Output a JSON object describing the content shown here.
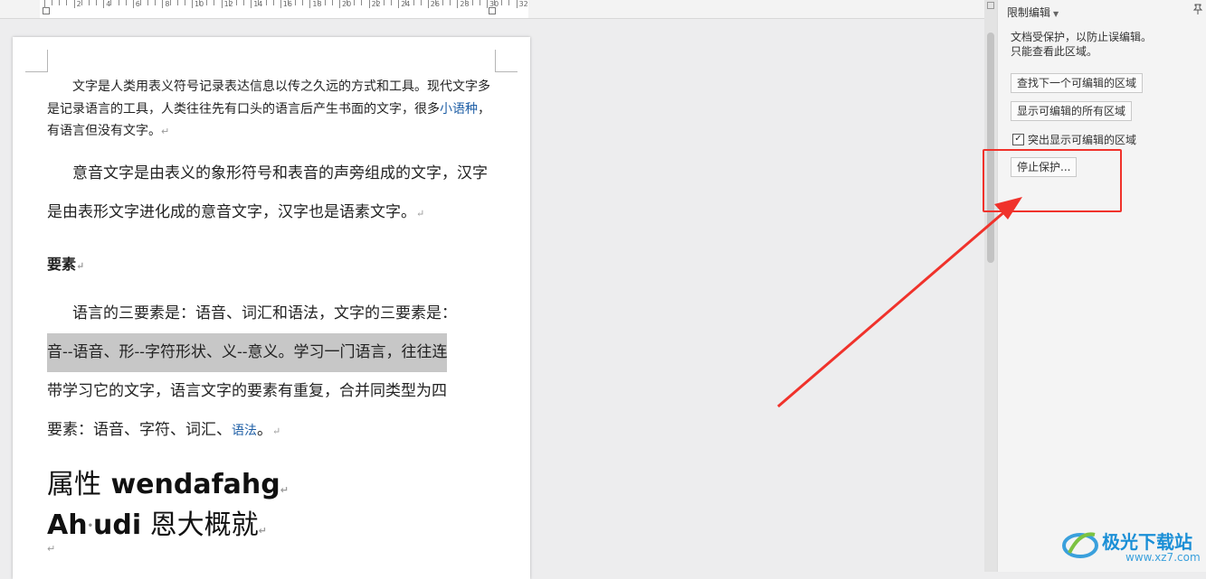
{
  "ruler": {
    "numbers": [
      "2",
      "4",
      "6",
      "8",
      "10",
      "12",
      "14",
      "16",
      "18",
      "20",
      "22",
      "24",
      "26",
      "28",
      "30",
      "32"
    ]
  },
  "document": {
    "para1": {
      "a": "文字是人类用表义符号记录表达信息以传之久远的方式和工具。现代文字多是记录语言的工具，人类往往先有口头的语言后产生书面的文字，很多",
      "link": "小语种",
      "b": "，有语言但没有文字。"
    },
    "para2": "意音文字是由表义的象形符号和表音的声旁组成的文字，汉字是由表形文字进化成的意音文字，汉字也是语素文字。",
    "heading": "要素",
    "para3": {
      "line1": "语言的三要素是：语音、词汇和语法，文字的三要素是：",
      "line2": "音--语音、形--字符形状、义--意义。学习一门语言，往往连",
      "line3": "带学习它的文字，语言文字的要素有重复，合并同类型为四",
      "line4a": "要素：语音、字符、词汇、",
      "line4link": "语法",
      "line4b": "。"
    },
    "big1": {
      "cjk": "属性",
      "latin": " wendafahg"
    },
    "big2": {
      "latin1": "Ah",
      "latin2": "udi",
      "cjk": " 恩大概就"
    },
    "para_mark": "↵"
  },
  "panel": {
    "title": "限制编辑",
    "info_line1": "文档受保护，以防止误编辑。",
    "info_line2": "只能查看此区域。",
    "btn_find_next": "查找下一个可编辑的区域",
    "btn_show_all": "显示可编辑的所有区域",
    "checkbox_label": "突出显示可编辑的区域",
    "checkbox_checked": "✓",
    "btn_stop": "停止保护..."
  },
  "watermark": {
    "name": "极光下载站",
    "url": "www.xz7.com"
  },
  "colors": {
    "annotation": "#f0322b",
    "link": "#1f5fa6",
    "highlight": "#c7c7c7"
  }
}
